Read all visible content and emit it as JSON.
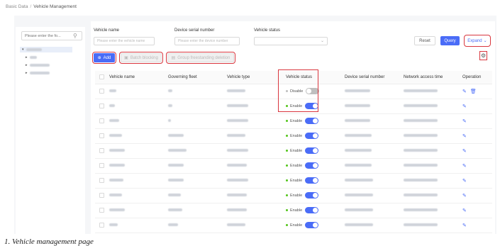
{
  "breadcrumb": {
    "parent": "Basic Data",
    "separator": "/",
    "current": "Vehicle Management"
  },
  "tree": {
    "search_placeholder": "Please enter the fo...",
    "search_icon": "search-icon"
  },
  "filters": {
    "vehicle_name": {
      "label": "Vehicle name",
      "placeholder": "Please enter the vehicle name"
    },
    "device_serial": {
      "label": "Device serial number",
      "placeholder": "Please enter the device number"
    },
    "vehicle_status": {
      "label": "Vehicle status",
      "value": ""
    }
  },
  "actions": {
    "reset": "Reset",
    "query": "Query",
    "expand": "Expand",
    "add": "Add",
    "batch_blocking": "Batch blocking",
    "group_deletion": "Group freestanding deletion"
  },
  "table": {
    "columns": [
      "Vehicle name",
      "Governing fleet",
      "Vehicle type",
      "Vehicle status",
      "Device serial number",
      "Network access time",
      "Operation"
    ],
    "rows": [
      {
        "status": "Disable",
        "enabled": false,
        "has_delete": true
      },
      {
        "status": "Enable",
        "enabled": true,
        "has_delete": false
      },
      {
        "status": "Enable",
        "enabled": true,
        "has_delete": false
      },
      {
        "status": "Enable",
        "enabled": true,
        "has_delete": false
      },
      {
        "status": "Enable",
        "enabled": true,
        "has_delete": false
      },
      {
        "status": "Enable",
        "enabled": true,
        "has_delete": false
      },
      {
        "status": "Enable",
        "enabled": true,
        "has_delete": false
      },
      {
        "status": "Enable",
        "enabled": true,
        "has_delete": false
      },
      {
        "status": "Enable",
        "enabled": true,
        "has_delete": false
      },
      {
        "status": "Enable",
        "enabled": true,
        "has_delete": false
      }
    ]
  },
  "caption": "1. Vehicle management page",
  "colors": {
    "accent": "#4a6cf7",
    "highlight": "#d9363e",
    "enabled_dot": "#52c41a"
  }
}
